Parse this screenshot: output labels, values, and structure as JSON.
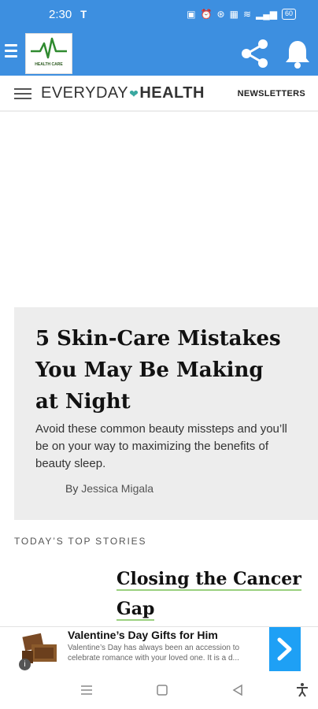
{
  "status_bar": {
    "time": "2:30",
    "left_icon": "teams-icon",
    "battery": "60"
  },
  "app_bar": {
    "logo_text": "HEALTH CARE",
    "icons": [
      "menu-icon",
      "share-icon",
      "bell-icon"
    ]
  },
  "site_header": {
    "brand_part1": "EVERYDAY",
    "brand_part2": "HEALTH",
    "newsletters_label": "NEWSLETTERS"
  },
  "hero": {
    "title": "5 Skin-Care Mistakes You May Be Making at Night",
    "summary": "Avoid these common beauty missteps and you’ll be on your way to maximizing the benefits of beauty sleep.",
    "byline_prefix": "By",
    "author": "Jessica Migala"
  },
  "top_stories": {
    "label": "TODAY’S TOP STORIES",
    "items": [
      {
        "title": "Closing the Cancer Gap"
      }
    ]
  },
  "ad": {
    "title": "Valentine’s Day Gifts for Him",
    "description": "Valentine’s Day has always been an accession to celebrate romance with your loved one. It is a d...",
    "info_icon": "i"
  },
  "colors": {
    "app_bar": "#3d8fe0",
    "ad_cta": "#1ea0f5",
    "card_bg": "#ededed",
    "link_underline": "#9ad07f"
  }
}
